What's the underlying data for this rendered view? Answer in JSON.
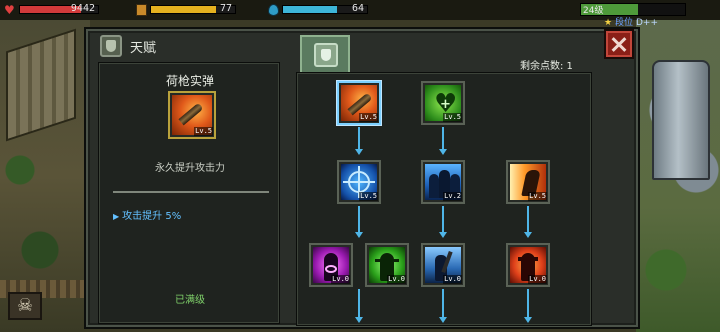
{
  "status": {
    "hp": {
      "value": "9442",
      "fill": 0.78,
      "color": "#d23a3a"
    },
    "food": {
      "value": "77",
      "fill": 0.77,
      "color": "#e5b21f"
    },
    "water": {
      "value": "64",
      "fill": 0.64,
      "color": "#3db6d8"
    },
    "level": {
      "label": "24级",
      "fill": 0.55
    },
    "rank": {
      "label": "段位",
      "grade": "D++"
    }
  },
  "dialog": {
    "title": "天赋",
    "points_label": "剩余点数: 1"
  },
  "selected_skill": {
    "name": "荷枪实弹",
    "description": "永久提升攻击力",
    "effect": "攻击提升 5%",
    "status": "已满级",
    "level_badge": "Lv.5"
  },
  "tree": {
    "nodes": [
      {
        "id": "bullet",
        "badge": "Lv.5",
        "theme": "orange-bullet",
        "selected": true
      },
      {
        "id": "heart",
        "badge": "Lv.5",
        "theme": "green-heart",
        "selected": false
      },
      {
        "id": "crosshair",
        "badge": "Lv.5",
        "theme": "blue-crosshair",
        "selected": false
      },
      {
        "id": "squad",
        "badge": "Lv.2",
        "theme": "blue-squad",
        "selected": false
      },
      {
        "id": "sprint",
        "badge": "Lv.5",
        "theme": "orange-sprint",
        "selected": false
      },
      {
        "id": "purple-power",
        "badge": "Lv.0",
        "theme": "purple-power",
        "selected": false
      },
      {
        "id": "green-power",
        "badge": "Lv.0",
        "theme": "green-power",
        "selected": false
      },
      {
        "id": "blue-axe",
        "badge": "Lv.0",
        "theme": "blue-axe",
        "selected": false
      },
      {
        "id": "red-demon",
        "badge": "Lv.0",
        "theme": "red-demon",
        "selected": false
      }
    ]
  }
}
